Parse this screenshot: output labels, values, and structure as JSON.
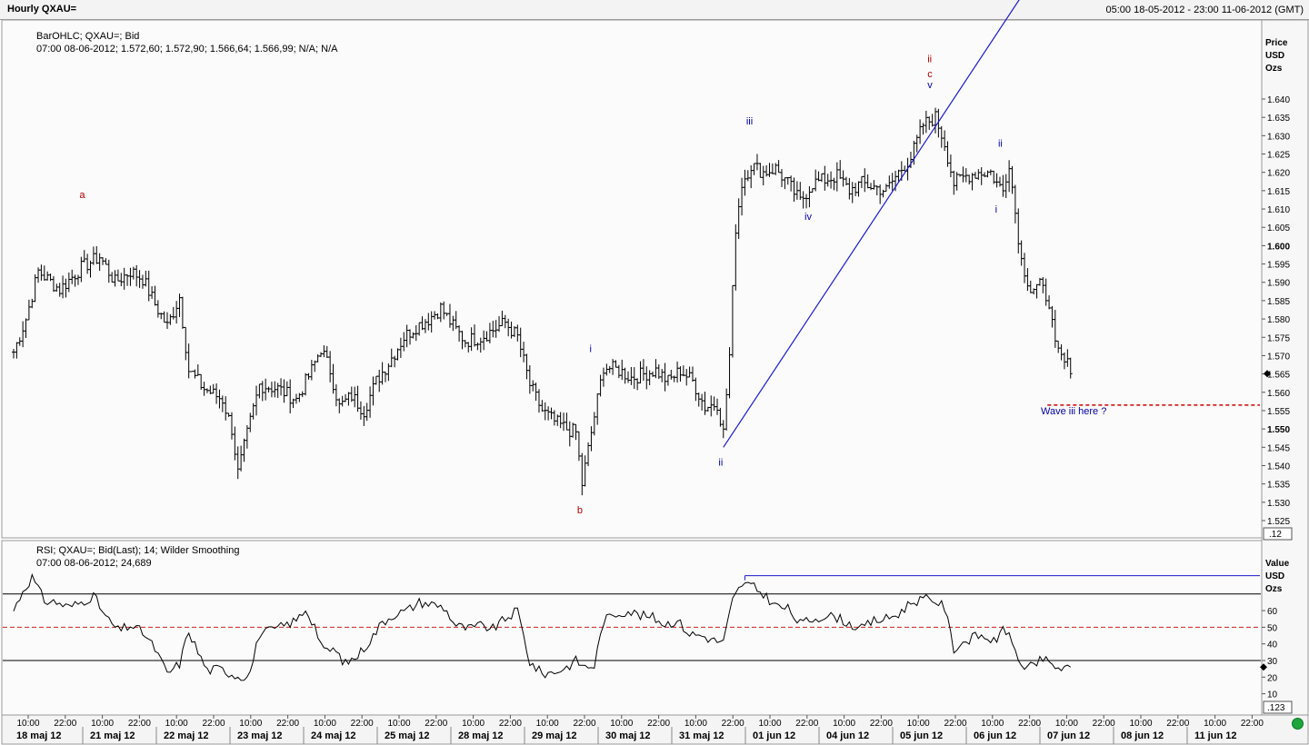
{
  "window": {
    "title": "Hourly QXAU=",
    "range": "05:00 18-05-2012 - 23:00 11-06-2012 (GMT)"
  },
  "colors": {
    "bars": "#000000",
    "elliott_red": "#b00000",
    "elliott_blue": "#0000a0",
    "trendline": "#1a1acc",
    "target_dash": "#cc0000",
    "rsi_mid_dash": "#cc2222",
    "rsi_upper_blue": "#1a1acc",
    "status_green": "#1ea53c"
  },
  "price_panel": {
    "legend_line1": "BarOHLC; QXAU=; Bid",
    "legend_line2": "07:00 08-06-2012; 1.572,60; 1.572,90; 1.566,64; 1.566,99; N/A; N/A",
    "axis_title": [
      "Price",
      "USD",
      "Ozs"
    ],
    "scale_box": ".12",
    "ticks": [
      "1.640",
      "1.635",
      "1.630",
      "1.625",
      "1.620",
      "1.615",
      "1.610",
      "1.605",
      "1.600",
      "1.595",
      "1.590",
      "1.585",
      "1.580",
      "1.575",
      "1.570",
      "1.565",
      "1.560",
      "1.555",
      "1.550",
      "1.545",
      "1.540",
      "1.535",
      "1.530",
      "1.525"
    ],
    "bold_ticks": [
      "1.600",
      "1.550"
    ],
    "annotation": "Wave iii here ?"
  },
  "rsi_panel": {
    "legend_line1": "RSI; QXAU=; Bid(Last);  14; Wilder Smoothing",
    "legend_line2": "07:00 08-06-2012; 24,689",
    "axis_title": [
      "Value",
      "USD",
      "Ozs"
    ],
    "scale_box": ".123",
    "ticks": [
      "60",
      "50",
      "40",
      "30",
      "20",
      "10"
    ]
  },
  "x_axis": {
    "time_labels": [
      "10:00",
      "22:00",
      "10:00",
      "22:00",
      "10:00",
      "22:00",
      "10:00",
      "22:00",
      "10:00",
      "22:00",
      "10:00",
      "22:00",
      "10:00",
      "22:00",
      "10:00",
      "22:00",
      "10:00",
      "22:00",
      "10:00",
      "22:00",
      "10:00",
      "22:00",
      "10:00",
      "22:00",
      "10:00",
      "22:00",
      "10:00",
      "22:00",
      "10:00",
      "22:00",
      "10:00",
      "22:00",
      "10:00",
      "22:00"
    ],
    "date_labels": [
      "18 maj 12",
      "21 maj 12",
      "22 maj 12",
      "23 maj 12",
      "24 maj 12",
      "25 maj 12",
      "28 maj 12",
      "29 maj 12",
      "30 maj 12",
      "31 maj 12",
      "01 jun 12",
      "04 jun 12",
      "05 jun 12",
      "06 jun 12",
      "07 jun 12",
      "08 jun 12",
      "11 jun 12"
    ]
  },
  "chart_data": [
    {
      "type": "ohlc",
      "title": "BarOHLC; QXAU=; Bid",
      "ylabel": "Price USD Ozs",
      "ylim": [
        1.522,
        1.648
      ],
      "x_unit": "hourly bar index (0 = 05:00 18-05-2012)",
      "waypoints": [
        [
          0,
          1.571
        ],
        [
          4,
          1.58
        ],
        [
          8,
          1.593
        ],
        [
          15,
          1.588
        ],
        [
          22,
          1.594
        ],
        [
          28,
          1.597
        ],
        [
          33,
          1.59
        ],
        [
          38,
          1.593
        ],
        [
          42,
          1.591
        ],
        [
          46,
          1.584
        ],
        [
          50,
          1.578
        ],
        [
          54,
          1.586
        ],
        [
          57,
          1.566
        ],
        [
          62,
          1.561
        ],
        [
          68,
          1.558
        ],
        [
          71,
          1.55
        ],
        [
          73,
          1.538
        ],
        [
          77,
          1.552
        ],
        [
          80,
          1.562
        ],
        [
          86,
          1.561
        ],
        [
          92,
          1.558
        ],
        [
          97,
          1.566
        ],
        [
          100,
          1.572
        ],
        [
          103,
          1.566
        ],
        [
          106,
          1.556
        ],
        [
          110,
          1.559
        ],
        [
          114,
          1.555
        ],
        [
          118,
          1.563
        ],
        [
          122,
          1.568
        ],
        [
          127,
          1.575
        ],
        [
          131,
          1.578
        ],
        [
          135,
          1.58
        ],
        [
          139,
          1.583
        ],
        [
          143,
          1.578
        ],
        [
          147,
          1.574
        ],
        [
          152,
          1.575
        ],
        [
          156,
          1.577
        ],
        [
          160,
          1.579
        ],
        [
          164,
          1.575
        ],
        [
          168,
          1.562
        ],
        [
          172,
          1.555
        ],
        [
          176,
          1.552
        ],
        [
          180,
          1.55
        ],
        [
          183,
          1.549
        ],
        [
          185,
          1.535
        ],
        [
          188,
          1.549
        ],
        [
          192,
          1.567
        ],
        [
          197,
          1.566
        ],
        [
          201,
          1.564
        ],
        [
          205,
          1.565
        ],
        [
          209,
          1.566
        ],
        [
          213,
          1.563
        ],
        [
          217,
          1.566
        ],
        [
          221,
          1.563
        ],
        [
          225,
          1.556
        ],
        [
          229,
          1.557
        ],
        [
          231,
          1.549
        ],
        [
          233,
          1.57
        ],
        [
          235,
          1.605
        ],
        [
          237,
          1.617
        ],
        [
          240,
          1.622
        ],
        [
          244,
          1.62
        ],
        [
          248,
          1.621
        ],
        [
          252,
          1.617
        ],
        [
          256,
          1.612
        ],
        [
          260,
          1.617
        ],
        [
          264,
          1.618
        ],
        [
          268,
          1.619
        ],
        [
          272,
          1.615
        ],
        [
          276,
          1.617
        ],
        [
          280,
          1.616
        ],
        [
          284,
          1.615
        ],
        [
          288,
          1.62
        ],
        [
          292,
          1.624
        ],
        [
          296,
          1.633
        ],
        [
          300,
          1.635
        ],
        [
          303,
          1.628
        ],
        [
          306,
          1.617
        ],
        [
          310,
          1.619
        ],
        [
          314,
          1.62
        ],
        [
          318,
          1.62
        ],
        [
          320,
          1.617
        ],
        [
          322,
          1.615
        ],
        [
          324,
          1.623
        ],
        [
          326,
          1.609
        ],
        [
          328,
          1.596
        ],
        [
          331,
          1.588
        ],
        [
          334,
          1.589
        ],
        [
          337,
          1.585
        ],
        [
          339,
          1.572
        ],
        [
          342,
          1.568
        ],
        [
          344,
          1.567
        ]
      ],
      "wave_labels": [
        {
          "label": "a",
          "x": 22,
          "y": 1.613,
          "color": "red"
        },
        {
          "label": "b",
          "x": 184,
          "y": 1.527,
          "color": "red"
        },
        {
          "label": "i",
          "x": 188,
          "y": 1.571,
          "color": "blue"
        },
        {
          "label": "ii",
          "x": 230,
          "y": 1.54,
          "color": "blue"
        },
        {
          "label": "iii",
          "x": 239,
          "y": 1.633,
          "color": "blue"
        },
        {
          "label": "iv",
          "x": 258,
          "y": 1.607,
          "color": "blue"
        },
        {
          "label": "ii",
          "x": 298,
          "y": 1.65,
          "color": "red"
        },
        {
          "label": "c",
          "x": 298,
          "y": 1.646,
          "color": "red"
        },
        {
          "label": "v",
          "x": 298,
          "y": 1.643,
          "color": "blue"
        },
        {
          "label": "ii",
          "x": 321,
          "y": 1.627,
          "color": "blue"
        },
        {
          "label": "i",
          "x": 320,
          "y": 1.609,
          "color": "blue"
        }
      ],
      "trendline": {
        "from": [
          231,
          1.545
        ],
        "to": [
          328,
          1.668
        ]
      },
      "target_level": {
        "y": 1.5565,
        "from_x": 335,
        "to_x": 380
      }
    },
    {
      "type": "line",
      "title": "RSI; QXAU=; Bid(Last);  14; Wilder Smoothing",
      "ylim": [
        0,
        88
      ],
      "levels": [
        70,
        50,
        30
      ],
      "upper_blue_level": {
        "y": 81,
        "from_x": 238,
        "to_x": 380
      },
      "last_value": 24.689,
      "waypoints": [
        [
          0,
          60
        ],
        [
          3,
          72
        ],
        [
          6,
          80
        ],
        [
          10,
          66
        ],
        [
          14,
          65
        ],
        [
          18,
          62
        ],
        [
          22,
          65
        ],
        [
          26,
          69
        ],
        [
          30,
          56
        ],
        [
          34,
          48
        ],
        [
          38,
          51
        ],
        [
          42,
          47
        ],
        [
          46,
          37
        ],
        [
          50,
          22
        ],
        [
          54,
          28
        ],
        [
          57,
          48
        ],
        [
          60,
          35
        ],
        [
          63,
          24
        ],
        [
          67,
          25
        ],
        [
          71,
          22
        ],
        [
          74,
          20
        ],
        [
          77,
          23
        ],
        [
          80,
          46
        ],
        [
          84,
          48
        ],
        [
          88,
          51
        ],
        [
          92,
          54
        ],
        [
          95,
          61
        ],
        [
          98,
          51
        ],
        [
          101,
          35
        ],
        [
          104,
          37
        ],
        [
          108,
          28
        ],
        [
          112,
          33
        ],
        [
          116,
          42
        ],
        [
          120,
          53
        ],
        [
          124,
          58
        ],
        [
          128,
          60
        ],
        [
          132,
          65
        ],
        [
          136,
          64
        ],
        [
          140,
          62
        ],
        [
          144,
          51
        ],
        [
          148,
          49
        ],
        [
          152,
          51
        ],
        [
          156,
          49
        ],
        [
          160,
          55
        ],
        [
          164,
          60
        ],
        [
          168,
          29
        ],
        [
          172,
          22
        ],
        [
          176,
          23
        ],
        [
          180,
          26
        ],
        [
          183,
          30
        ],
        [
          186,
          26
        ],
        [
          189,
          27
        ],
        [
          192,
          54
        ],
        [
          196,
          58
        ],
        [
          200,
          60
        ],
        [
          204,
          57
        ],
        [
          208,
          56
        ],
        [
          212,
          52
        ],
        [
          216,
          54
        ],
        [
          220,
          46
        ],
        [
          224,
          45
        ],
        [
          228,
          42
        ],
        [
          231,
          41
        ],
        [
          234,
          66
        ],
        [
          237,
          76
        ],
        [
          240,
          75
        ],
        [
          244,
          70
        ],
        [
          248,
          63
        ],
        [
          252,
          61
        ],
        [
          256,
          52
        ],
        [
          260,
          55
        ],
        [
          264,
          57
        ],
        [
          268,
          56
        ],
        [
          272,
          52
        ],
        [
          276,
          49
        ],
        [
          280,
          54
        ],
        [
          284,
          55
        ],
        [
          288,
          58
        ],
        [
          292,
          65
        ],
        [
          296,
          67
        ],
        [
          300,
          66
        ],
        [
          303,
          62
        ],
        [
          306,
          37
        ],
        [
          310,
          42
        ],
        [
          314,
          45
        ],
        [
          318,
          43
        ],
        [
          320,
          39
        ],
        [
          322,
          52
        ],
        [
          326,
          36
        ],
        [
          329,
          24
        ],
        [
          332,
          27
        ],
        [
          335,
          31
        ],
        [
          338,
          27
        ],
        [
          341,
          25
        ],
        [
          344,
          25
        ]
      ]
    }
  ]
}
